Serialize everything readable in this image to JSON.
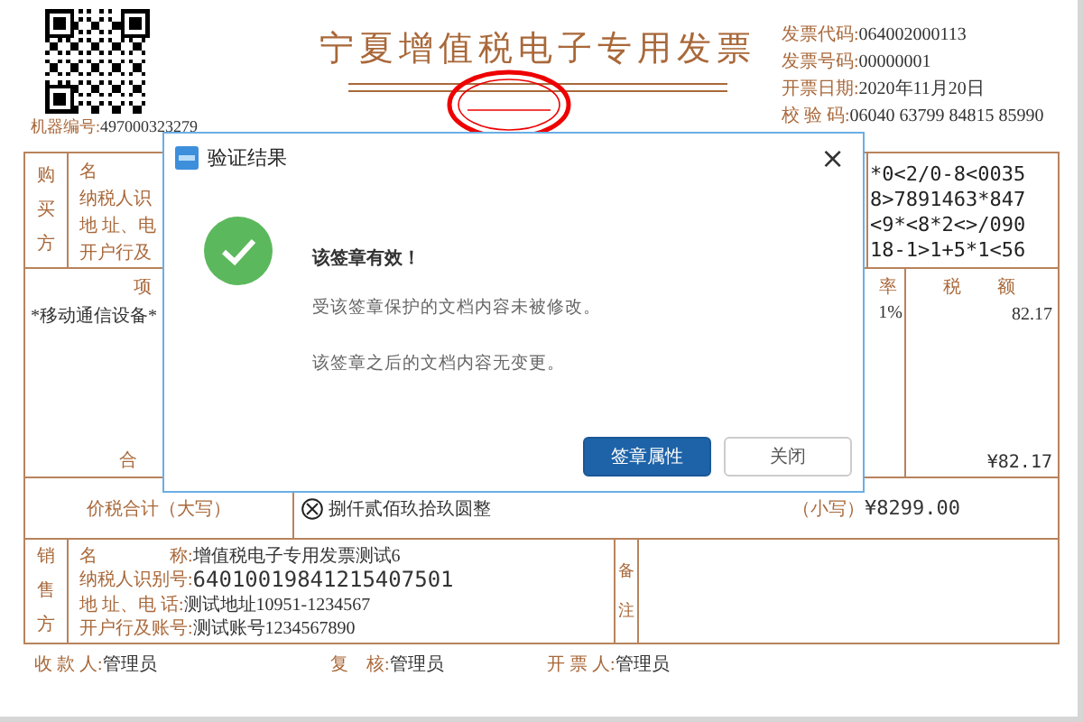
{
  "invoice": {
    "title": "宁夏增值税电子专用发票",
    "machine_no": {
      "label": "机器编号:",
      "value": "497000323279"
    },
    "info": [
      {
        "label": "发票代码:",
        "value": "064002000113"
      },
      {
        "label": "发票号码:",
        "value": "00000001"
      },
      {
        "label": "开票日期:",
        "value": "2020年11月20日"
      },
      {
        "label": "校 验 码:",
        "value": "06040 63799 84815 85990"
      }
    ],
    "buyer": {
      "side_label": "购买方",
      "fields": [
        "名",
        "纳税人识",
        "地 址、电",
        "开户行及"
      ]
    },
    "password_lines": [
      "*0<2/0-8<0035",
      "8>7891463*847",
      "<9*<8*2<>/090",
      "18-1>1+5*1<56"
    ],
    "items": {
      "header_name": "项",
      "header_rate": "率",
      "header_tax": "税　　额",
      "rows": [
        {
          "name": "*移动通信设备*",
          "rate": "1%",
          "tax": "82.17"
        }
      ],
      "total_label": "合",
      "total_tax": "¥82.17"
    },
    "grand_total": {
      "label": "价税合计（大写）",
      "words": "捌仟贰佰玖拾玖圆整",
      "small_label": "（小写）",
      "amount": "¥8299.00"
    },
    "seller": {
      "side_label": "销售方",
      "fields": [
        {
          "label": "名　　　　称:",
          "value": "增值税电子专用发票测试6",
          "kind": "text"
        },
        {
          "label": "纳税人识别号:",
          "value": "64010019841215407501",
          "kind": "code"
        },
        {
          "label": "地 址、电 话:",
          "value": "测试地址10951-1234567",
          "kind": "text"
        },
        {
          "label": "开户行及账号:",
          "value": "测试账号1234567890",
          "kind": "text"
        }
      ],
      "remarks_label": "备注"
    },
    "signatures": [
      {
        "label": "收 款 人:",
        "value": "管理员"
      },
      {
        "label": "复　核:",
        "value": "管理员"
      },
      {
        "label": "开 票 人:",
        "value": "管理员"
      }
    ]
  },
  "dialog": {
    "title": "验证结果",
    "close": "×",
    "heading": "该签章有效！",
    "lines": [
      "受该签章保护的文档内容未被修改。",
      "该签章之后的文档内容无变更。"
    ],
    "buttons": [
      {
        "label": "签章属性",
        "primary": true
      },
      {
        "label": "关闭",
        "primary": false
      }
    ]
  }
}
